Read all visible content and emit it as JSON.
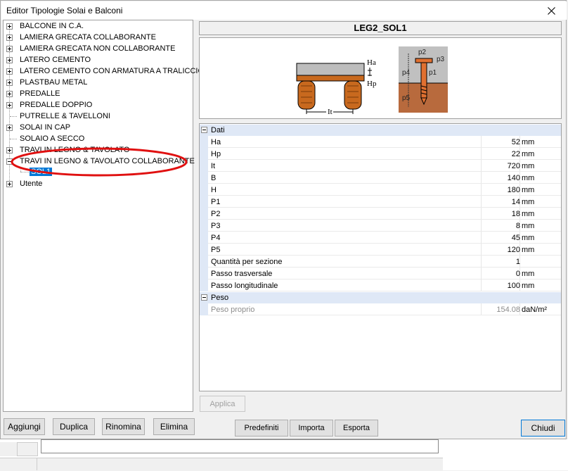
{
  "window": {
    "title": "Editor Tipologie Solai e Balconi"
  },
  "tree": {
    "items": [
      {
        "label": "BALCONE IN C.A.",
        "expandable": true
      },
      {
        "label": "LAMIERA GRECATA COLLABORANTE",
        "expandable": true
      },
      {
        "label": "LAMIERA GRECATA NON COLLABORANTE",
        "expandable": true
      },
      {
        "label": "LATERO CEMENTO",
        "expandable": true
      },
      {
        "label": "LATERO CEMENTO CON ARMATURA A TRALICCIO",
        "expandable": true
      },
      {
        "label": "PLASTBAU METAL",
        "expandable": true
      },
      {
        "label": "PREDALLE",
        "expandable": true
      },
      {
        "label": "PREDALLE DOPPIO",
        "expandable": true
      },
      {
        "label": "PUTRELLE & TAVELLONI",
        "expandable": false
      },
      {
        "label": "SOLAI IN CAP",
        "expandable": true
      },
      {
        "label": "SOLAIO A SECCO",
        "expandable": false
      },
      {
        "label": "TRAVI IN LEGNO & TAVOLATO",
        "expandable": true
      },
      {
        "label": "TRAVI IN LEGNO & TAVOLATO COLLABORANTE",
        "expandable": true,
        "expanded": true
      },
      {
        "label": "SOL1",
        "child": true,
        "selected": true
      },
      {
        "label": "Utente",
        "expandable": true
      }
    ]
  },
  "header": {
    "name": "LEG2_SOL1"
  },
  "diagram": {
    "labels": {
      "ha": "Ha",
      "hp": "Hp",
      "it": "It",
      "p1": "p1",
      "p2": "p2",
      "p3": "p3",
      "p4": "p4",
      "p5": "p5"
    }
  },
  "grid": {
    "cat_dati": "Dati",
    "cat_peso": "Peso",
    "rows": [
      {
        "name": "Ha",
        "value": "52",
        "unit": "mm"
      },
      {
        "name": "Hp",
        "value": "22",
        "unit": "mm"
      },
      {
        "name": "It",
        "value": "720",
        "unit": "mm"
      },
      {
        "name": "B",
        "value": "140",
        "unit": "mm"
      },
      {
        "name": "H",
        "value": "180",
        "unit": "mm"
      },
      {
        "name": "P1",
        "value": "14",
        "unit": "mm"
      },
      {
        "name": "P2",
        "value": "18",
        "unit": "mm"
      },
      {
        "name": "P3",
        "value": "8",
        "unit": "mm"
      },
      {
        "name": "P4",
        "value": "45",
        "unit": "mm"
      },
      {
        "name": "P5",
        "value": "120",
        "unit": "mm"
      },
      {
        "name": "Quantità per sezione",
        "value": "1",
        "unit": ""
      },
      {
        "name": "Passo trasversale",
        "value": "0",
        "unit": "mm"
      },
      {
        "name": "Passo longitudinale",
        "value": "100",
        "unit": "mm"
      }
    ],
    "peso_row": {
      "name": "Peso proprio",
      "value": "154.08",
      "unit": "daN/m²"
    }
  },
  "buttons": {
    "applica": "Applica",
    "aggiungi": "Aggiungi",
    "duplica": "Duplica",
    "rinomina": "Rinomina",
    "elimina": "Elimina",
    "predefiniti": "Predefiniti",
    "importa": "Importa",
    "esporta": "Esporta",
    "chiudi": "Chiudi"
  },
  "colors": {
    "selection": "#0078d7",
    "annotation": "#e01010",
    "category_bg": "#dfe8f6",
    "wood": "#c8691e",
    "screw": "#e07030"
  }
}
